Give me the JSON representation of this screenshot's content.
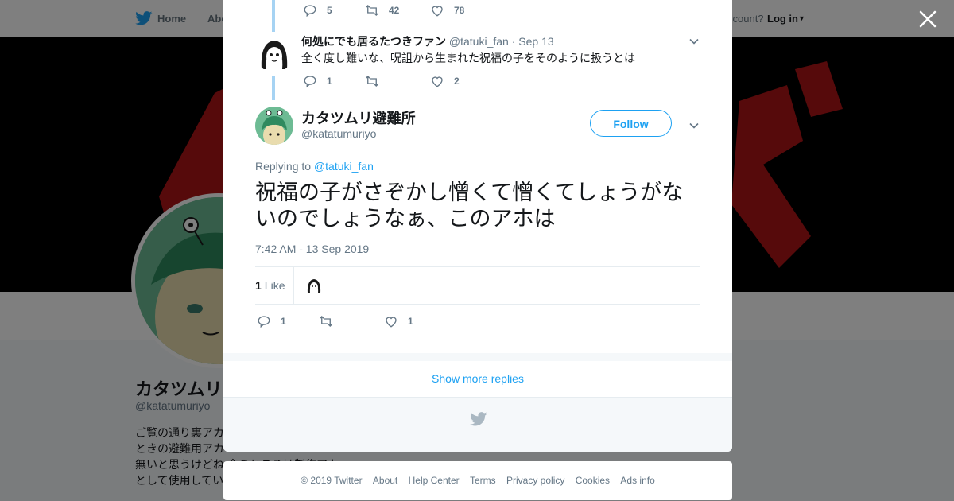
{
  "nav": {
    "home_label": "Home",
    "about_label": "Abo",
    "account_prompt": "ccount?",
    "login_label": "Log in"
  },
  "profile": {
    "name": "カタツムリ",
    "handle": "@katatumuriyo",
    "bio_lines": [
      "ご覧の通り裏アカ",
      "ときの避難用アカ",
      "無いと思うけどね 今のところは制作アカ",
      "として使用してい"
    ]
  },
  "thread": {
    "prev_tweet_actions": {
      "replies": "5",
      "retweets": "42",
      "likes": "78"
    },
    "reply": {
      "name": "何処にでも居るたつきファン",
      "handle": "@tatuki_fan",
      "separator": "·",
      "date": "Sep 13",
      "text": "全く度し難いな、呪詛から生まれた祝福の子をそのように扱うとは",
      "actions": {
        "replies": "1",
        "retweets": "",
        "likes": "2"
      }
    }
  },
  "tweet": {
    "name": "カタツムリ避難所",
    "handle": "@katatumuriyo",
    "follow_label": "Follow",
    "replying_prefix": "Replying to",
    "replying_to": "@tatuki_fan",
    "text": "祝福の子がさぞかし憎くて憎くてしょうがないのでしょうなぁ、このアホは",
    "timestamp": "7:42 AM - 13 Sep 2019",
    "likes_count": "1",
    "likes_label": "Like",
    "actions": {
      "replies": "1",
      "retweets": "",
      "likes": "1"
    }
  },
  "show_more_label": "Show more replies",
  "footer": {
    "links": [
      "© 2019 Twitter",
      "About",
      "Help Center",
      "Terms",
      "Privacy policy",
      "Cookies",
      "Ads info"
    ]
  },
  "icons": {
    "bird": "twitter-bird-icon",
    "close": "close-icon",
    "reply": "reply-icon",
    "retweet": "retweet-icon",
    "like": "heart-icon",
    "more": "chevron-down-icon"
  },
  "colors": {
    "brand_blue": "#1da1f2",
    "thread_line": "#a6d3f3",
    "muted_text": "#657786",
    "banner_red": "#c0161a"
  }
}
